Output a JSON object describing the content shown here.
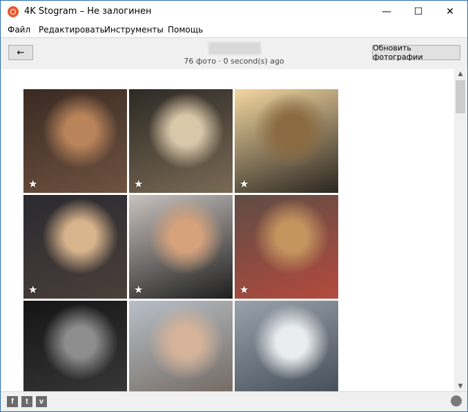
{
  "window": {
    "title": "4K Stogram – Не залогинен",
    "controls": {
      "minimize": "—",
      "maximize": "☐",
      "close": "✕"
    }
  },
  "menu": {
    "items": [
      {
        "label": "Файл"
      },
      {
        "label": "Редактировать"
      },
      {
        "label": "Инструменты"
      },
      {
        "label": "Помощь"
      }
    ]
  },
  "toolbar": {
    "back_label": "←",
    "status": "76 фото · 0 second(s) ago",
    "refresh_label": "Обновить фотографии"
  },
  "photos": [
    {
      "starred": true,
      "star": "★",
      "colors": [
        "#3a2a22",
        "#b9845a",
        "#6e5240"
      ]
    },
    {
      "starred": true,
      "star": "★",
      "colors": [
        "#2d2a25",
        "#d9c7a9",
        "#7a6a55"
      ]
    },
    {
      "starred": true,
      "star": "★",
      "colors": [
        "#f3d7a0",
        "#8a6a40",
        "#2a2520"
      ]
    },
    {
      "starred": true,
      "star": "★",
      "colors": [
        "#2a2a30",
        "#d8b48c",
        "#4a3f3a"
      ]
    },
    {
      "starred": true,
      "star": "★",
      "colors": [
        "#c9c3bf",
        "#d6a27c",
        "#1e1e1e"
      ]
    },
    {
      "starred": true,
      "star": "★",
      "colors": [
        "#5e4c45",
        "#c5955f",
        "#b54a3d"
      ]
    },
    {
      "starred": false,
      "star": "",
      "colors": [
        "#151515",
        "#8d8d8d",
        "#3a3a3a"
      ]
    },
    {
      "starred": false,
      "star": "",
      "colors": [
        "#b7c0c7",
        "#d4b39a",
        "#6f625a"
      ]
    },
    {
      "starred": false,
      "star": "",
      "colors": [
        "#9aa2ab",
        "#e9edf0",
        "#3e4850"
      ]
    }
  ],
  "footer": {
    "social": [
      {
        "name": "facebook",
        "glyph": "f"
      },
      {
        "name": "twitter",
        "glyph": "t"
      },
      {
        "name": "vimeo",
        "glyph": "v"
      }
    ],
    "language_icon": "globe-icon"
  }
}
